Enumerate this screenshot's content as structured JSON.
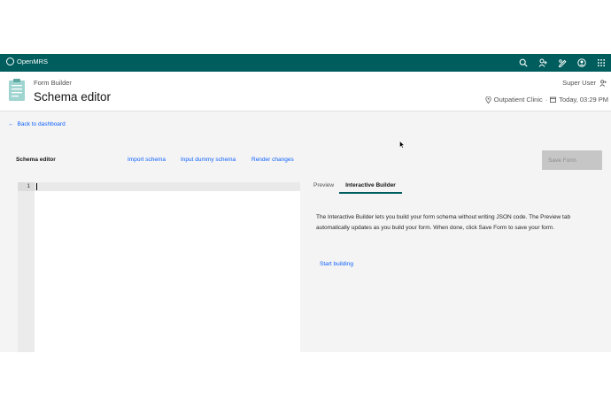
{
  "topnav": {
    "brand": "OpenMRS",
    "icons": [
      "search-icon",
      "add-patient-icon",
      "edit-icon",
      "user-avatar-icon",
      "app-switcher-icon"
    ]
  },
  "header": {
    "breadcrumb": "Form Builder",
    "title": "Schema editor",
    "user": "Super User",
    "location": "Outpatient Clinic",
    "separator": "·",
    "date": "Today, 03:29 PM"
  },
  "nav": {
    "back": "Back to dashboard"
  },
  "toolbar": {
    "label": "Schema editor",
    "import": "Import schema",
    "dummy": "Input dummy schema",
    "render": "Render changes",
    "save": "Save Form"
  },
  "editor": {
    "line_number": "1"
  },
  "tabs": [
    {
      "label": "Preview",
      "active": false
    },
    {
      "label": "Interactive Builder",
      "active": true
    }
  ],
  "builder": {
    "description": "The Interactive Builder lets you build your form schema without writing JSON code. The Preview tab automatically updates as you build your form. When done, click Save Form to save your form.",
    "start": "Start building"
  },
  "colors": {
    "nav_bg": "#005d5d",
    "link": "#0f62fe",
    "disabled_button": "#c6c6c6",
    "page_bg": "#f4f4f4"
  }
}
